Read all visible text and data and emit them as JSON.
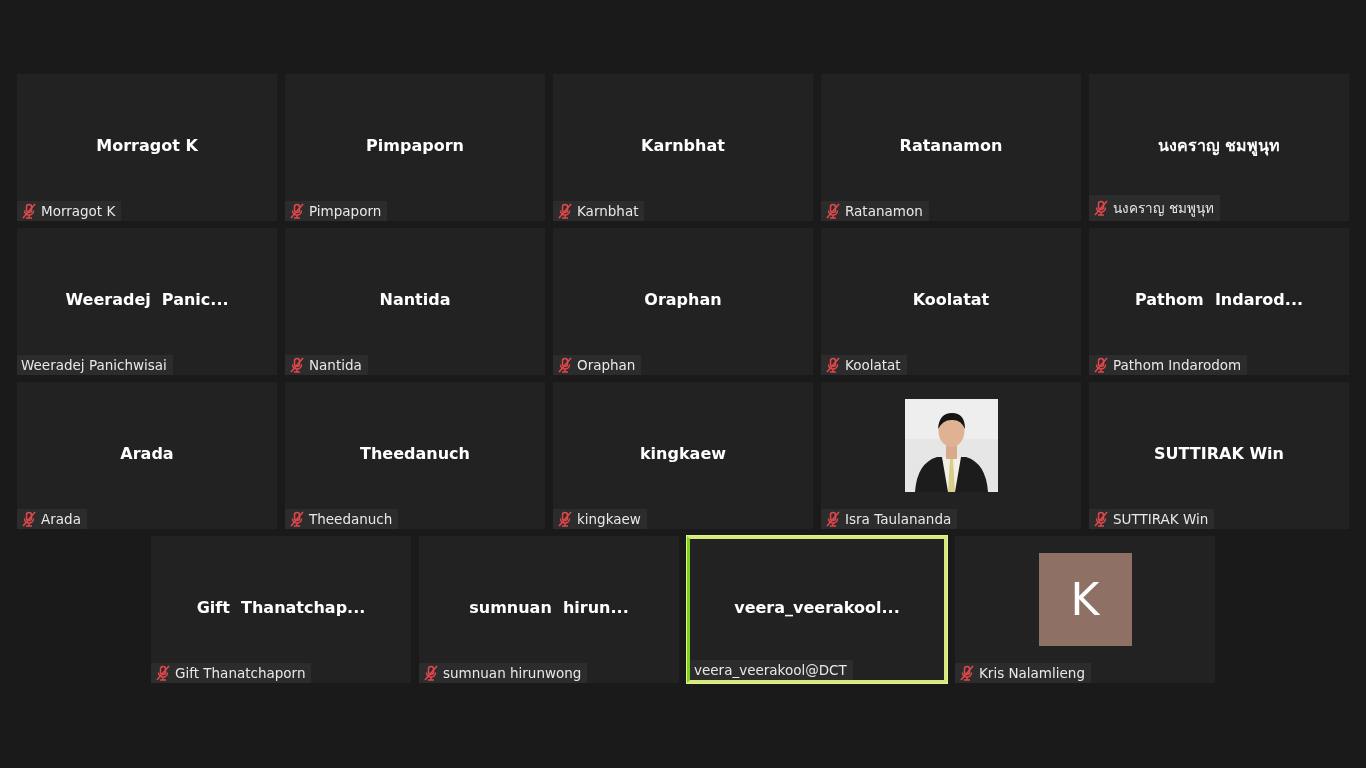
{
  "rows": [
    {
      "tiles": [
        {
          "kind": "name",
          "heading": "Morragot K",
          "label": "Morragot K",
          "muted": true,
          "speaking": false
        },
        {
          "kind": "name",
          "heading": "Pimpaporn",
          "label": "Pimpaporn",
          "muted": true,
          "speaking": false
        },
        {
          "kind": "name",
          "heading": "Karnbhat",
          "label": "Karnbhat",
          "muted": true,
          "speaking": false
        },
        {
          "kind": "name",
          "heading": "Ratanamon",
          "label": "Ratanamon",
          "muted": true,
          "speaking": false
        },
        {
          "kind": "name",
          "heading": "นงคราญ ชมพูนุท",
          "label": "นงคราญ ชมพูนุท",
          "muted": true,
          "speaking": false
        }
      ]
    },
    {
      "tiles": [
        {
          "kind": "name",
          "heading": "Weeradej  Panic...",
          "label": "Weeradej Panichwisai",
          "muted": false,
          "speaking": false
        },
        {
          "kind": "name",
          "heading": "Nantida",
          "label": "Nantida",
          "muted": true,
          "speaking": false
        },
        {
          "kind": "name",
          "heading": "Oraphan",
          "label": "Oraphan",
          "muted": true,
          "speaking": false
        },
        {
          "kind": "name",
          "heading": "Koolatat",
          "label": "Koolatat",
          "muted": true,
          "speaking": false
        },
        {
          "kind": "name",
          "heading": "Pathom  Indarod...",
          "label": "Pathom Indarodom",
          "muted": true,
          "speaking": false
        }
      ]
    },
    {
      "tiles": [
        {
          "kind": "name",
          "heading": "Arada",
          "label": "Arada",
          "muted": true,
          "speaking": false
        },
        {
          "kind": "name",
          "heading": "Theedanuch",
          "label": "Theedanuch",
          "muted": true,
          "speaking": false
        },
        {
          "kind": "name",
          "heading": "kingkaew",
          "label": "kingkaew",
          "muted": true,
          "speaking": false
        },
        {
          "kind": "picture",
          "label": "Isra Taulananda",
          "muted": true,
          "speaking": false
        },
        {
          "kind": "name",
          "heading": "SUTTIRAK Win",
          "label": "SUTTIRAK Win",
          "muted": true,
          "speaking": false
        }
      ]
    },
    {
      "tiles": [
        {
          "kind": "name",
          "heading": "Gift  Thanatchap...",
          "label": "Gift Thanatchaporn",
          "muted": true,
          "speaking": false
        },
        {
          "kind": "name",
          "heading": "sumnuan  hirun...",
          "label": "sumnuan hirunwong",
          "muted": true,
          "speaking": false
        },
        {
          "kind": "name",
          "heading": "veera_veerakool...",
          "label": "veera_veerakool@DCT",
          "muted": false,
          "speaking": true
        },
        {
          "kind": "avatar",
          "initial": "K",
          "label": "Kris Nalamlieng",
          "muted": true,
          "speaking": false
        }
      ]
    }
  ]
}
